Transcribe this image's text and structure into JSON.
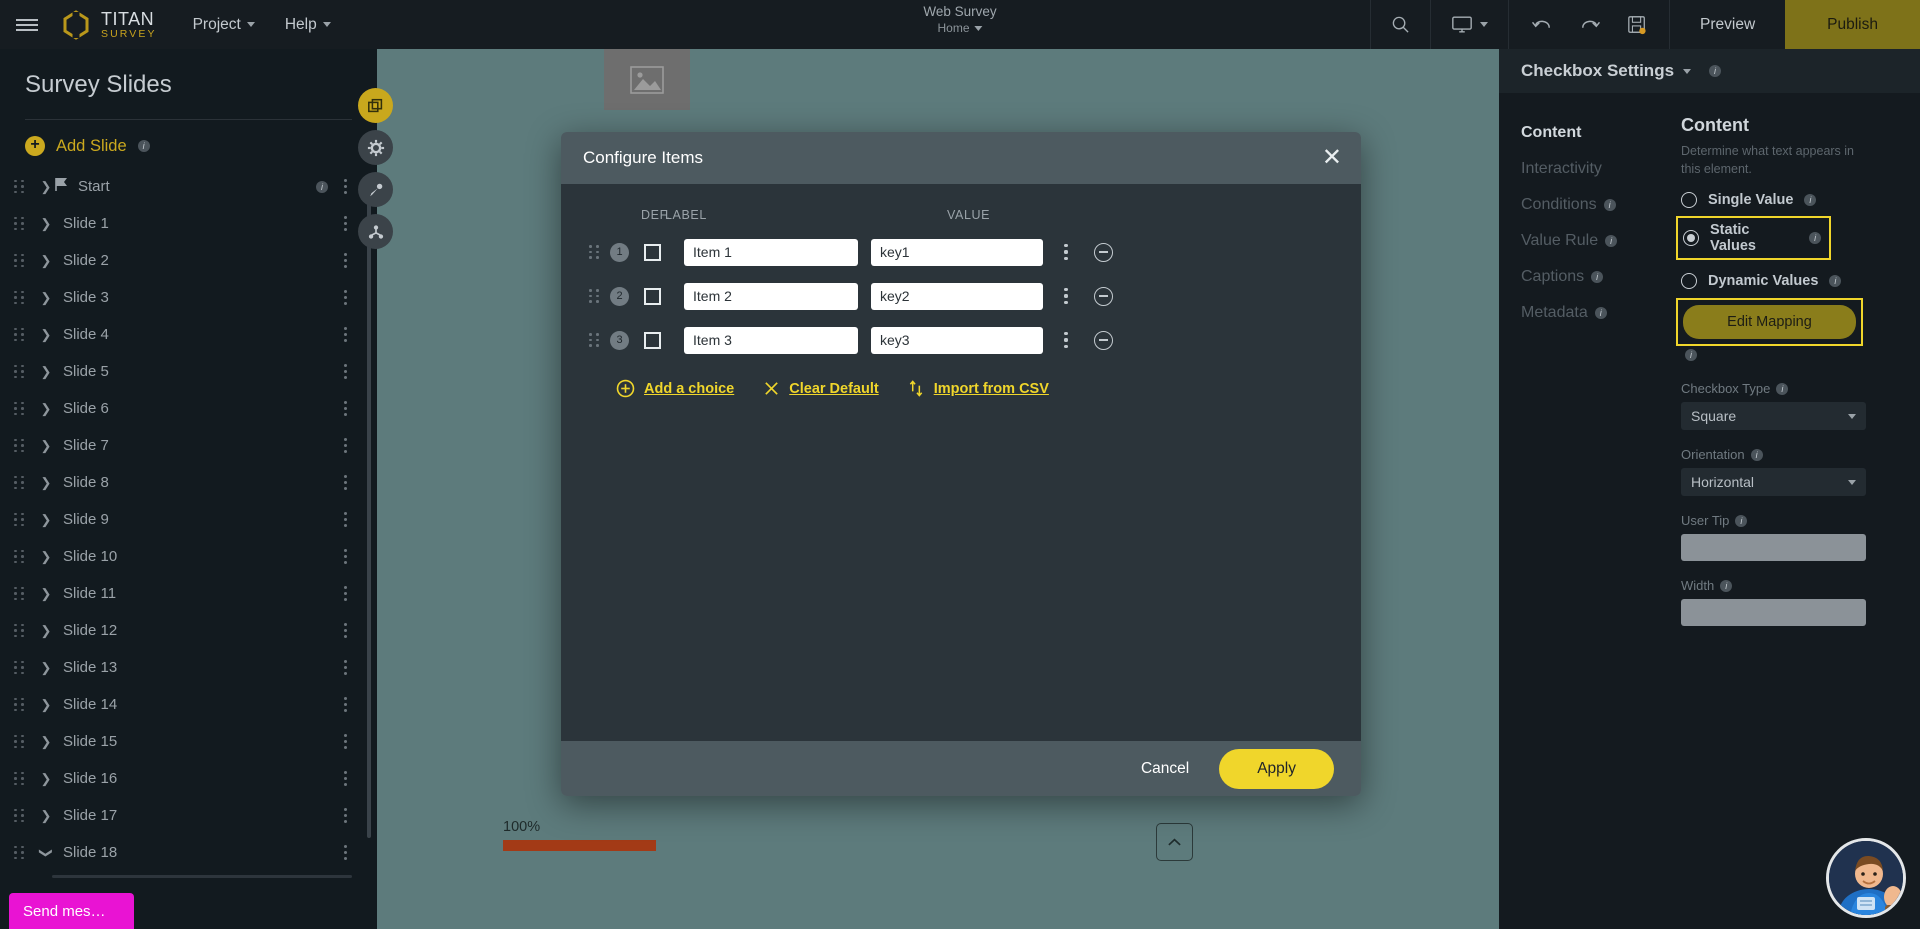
{
  "topbar": {
    "brand_name": "TITAN",
    "brand_sub": "SURVEY",
    "nav": [
      {
        "label": "Project"
      },
      {
        "label": "Help"
      }
    ],
    "doc_title": "Web Survey",
    "doc_breadcrumb": "Home",
    "search_icon": "search-icon",
    "device_icon": "monitor-icon",
    "undo_icon": "undo-icon",
    "redo_icon": "redo-icon",
    "save_icon": "save-icon",
    "preview_label": "Preview",
    "publish_label": "Publish",
    "accent_yellow": "#f0d62b",
    "publish_bg": "#7e7219"
  },
  "sidebar": {
    "title": "Survey Slides",
    "add_slide_label": "Add Slide",
    "info_glyph": "i",
    "start_label": "Start",
    "slides": [
      {
        "label": "Slide 1"
      },
      {
        "label": "Slide 2"
      },
      {
        "label": "Slide 3"
      },
      {
        "label": "Slide 4"
      },
      {
        "label": "Slide 5"
      },
      {
        "label": "Slide 6"
      },
      {
        "label": "Slide 7"
      },
      {
        "label": "Slide 8"
      },
      {
        "label": "Slide 9"
      },
      {
        "label": "Slide 10"
      },
      {
        "label": "Slide 11"
      },
      {
        "label": "Slide 12"
      },
      {
        "label": "Slide 13"
      },
      {
        "label": "Slide 14"
      },
      {
        "label": "Slide 15"
      },
      {
        "label": "Slide 16"
      },
      {
        "label": "Slide 17"
      },
      {
        "label": "Slide 18"
      }
    ],
    "send_message_label": "Send mes…",
    "send_message_color": "#e913d3"
  },
  "float_tools": [
    {
      "icon": "layers-copy-icon",
      "active": true
    },
    {
      "icon": "gear-icon",
      "active": false
    },
    {
      "icon": "brush-icon",
      "active": false
    },
    {
      "icon": "node-merge-icon",
      "active": false
    }
  ],
  "canvas": {
    "progress_label": "100%",
    "progress_value": 100,
    "progress_color": "#a33a16",
    "scroll_top_icon": "chevron-up-icon",
    "image_placeholder_icon": "image-icon",
    "background_color": "#5d7b7c"
  },
  "modal": {
    "title": "Configure Items",
    "close_icon": "close-icon",
    "columns": {
      "def": "DEF.",
      "label": "LABEL",
      "value": "VALUE"
    },
    "rows": [
      {
        "num": "1",
        "checked": false,
        "label": "Item 1",
        "value": "key1"
      },
      {
        "num": "2",
        "checked": false,
        "label": "Item 2",
        "value": "key2"
      },
      {
        "num": "3",
        "checked": false,
        "label": "Item 3",
        "value": "key3"
      }
    ],
    "links": [
      {
        "icon": "plus-circle-icon",
        "label": "Add a choice"
      },
      {
        "icon": "close-x-icon",
        "label": "Clear Default"
      },
      {
        "icon": "import-arrows-icon",
        "label": "Import from CSV"
      }
    ],
    "cancel_label": "Cancel",
    "apply_label": "Apply"
  },
  "right_panel": {
    "header_title": "Checkbox Settings",
    "header_caret_icon": "chevron-down-icon",
    "tabs": [
      {
        "label": "Content",
        "active": true,
        "info": false
      },
      {
        "label": "Interactivity",
        "active": false,
        "info": false
      },
      {
        "label": "Conditions",
        "active": false,
        "info": true
      },
      {
        "label": "Value Rule",
        "active": false,
        "info": true
      },
      {
        "label": "Captions",
        "active": false,
        "info": true
      },
      {
        "label": "Metadata",
        "active": false,
        "info": true
      }
    ],
    "content": {
      "heading": "Content",
      "description": "Determine what text appears in this element.",
      "radios": [
        {
          "label": "Single Value",
          "selected": false,
          "highlighted": false
        },
        {
          "label": "Static Values",
          "selected": true,
          "highlighted": true
        },
        {
          "label": "Dynamic Values",
          "selected": false,
          "highlighted": false
        }
      ],
      "edit_mapping_label": "Edit Mapping",
      "fields": [
        {
          "label": "Checkbox Type",
          "type": "select",
          "value": "Square"
        },
        {
          "label": "Orientation",
          "type": "select",
          "value": "Horizontal"
        },
        {
          "label": "User Tip",
          "type": "text",
          "value": ""
        },
        {
          "label": "Width",
          "type": "text",
          "value": ""
        }
      ]
    },
    "highlight_color": "#f0d62b"
  },
  "chat": {
    "avatar_icon": "support-hero-avatar"
  }
}
